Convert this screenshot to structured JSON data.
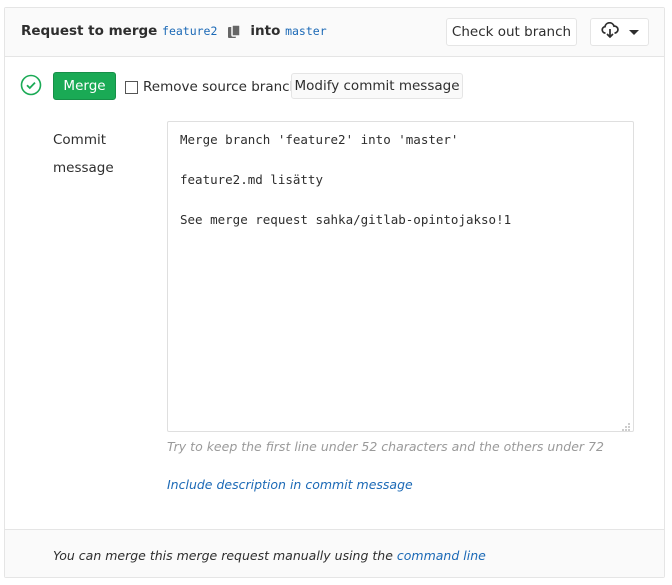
{
  "header": {
    "title_prefix": "Request to merge",
    "source_branch": "feature2",
    "into_label": "into",
    "target_branch": "master",
    "checkout_label": "Check out branch"
  },
  "actions": {
    "merge_label": "Merge",
    "remove_source_label": "Remove source branch",
    "remove_source_checked": false,
    "modify_label": "Modify commit message"
  },
  "commit": {
    "label_line1": "Commit",
    "label_line2": "message",
    "message": "Merge branch 'feature2' into 'master'\n\nfeature2.md lisätty\n\nSee merge request sahka/gitlab-opintojakso!1",
    "hint": "Try to keep the first line under 52 characters and the others under 72",
    "include_description_label": "Include description in commit message"
  },
  "footer": {
    "text": "You can merge this merge request manually using the",
    "link_label": "command line"
  },
  "colors": {
    "merge_green": "#1aaa55",
    "link_blue": "#1b69b6",
    "status_green": "#1aaa55"
  },
  "icons": {
    "copy": "clipboard-icon",
    "download": "cloud-download-icon",
    "dropdown": "caret-down-icon",
    "status": "check-circle-icon"
  }
}
